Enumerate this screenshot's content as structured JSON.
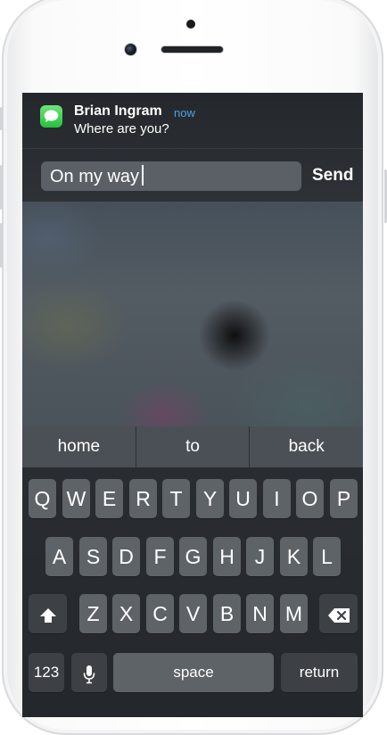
{
  "notification": {
    "app_icon": "messages-icon",
    "sender": "Brian Ingram",
    "time": "now",
    "message": "Where are you?",
    "reply_text": "On my way",
    "send_label": "Send",
    "time_color": "#4aa3e6"
  },
  "predictive": [
    "home",
    "to",
    "back"
  ],
  "keyboard": {
    "row1": [
      "Q",
      "W",
      "E",
      "R",
      "T",
      "Y",
      "U",
      "I",
      "O",
      "P"
    ],
    "row2": [
      "A",
      "S",
      "D",
      "F",
      "G",
      "H",
      "J",
      "K",
      "L"
    ],
    "row3": [
      "Z",
      "X",
      "C",
      "V",
      "B",
      "N",
      "M"
    ],
    "numbers_label": "123",
    "space_label": "space",
    "return_label": "return",
    "shift_icon": "shift-arrow-icon",
    "delete_icon": "backspace-icon",
    "mic_icon": "microphone-icon"
  }
}
